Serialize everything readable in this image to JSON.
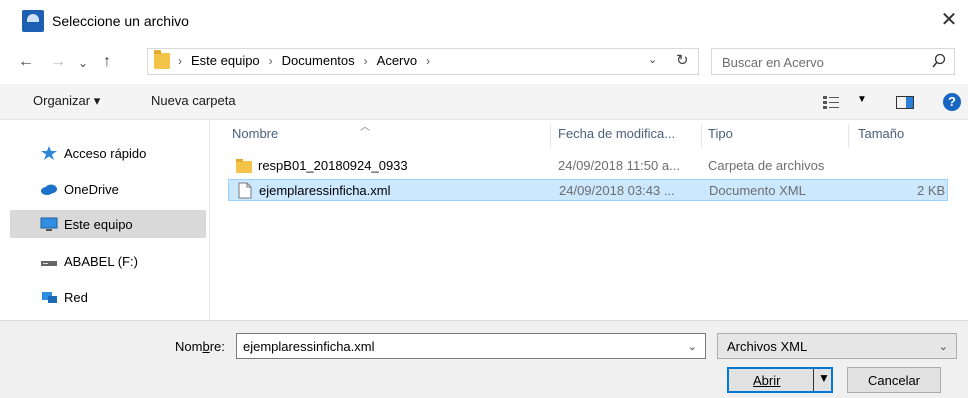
{
  "window": {
    "title": "Seleccione un archivo",
    "close_glyph": "✕"
  },
  "nav": {
    "back_glyph": "←",
    "forward_glyph": "→",
    "recent_glyph": "⌄",
    "up_glyph": "↑",
    "breadcrumbs": [
      "Este equipo",
      "Documentos",
      "Acervo"
    ],
    "crumb_separator": "›",
    "search_placeholder": "Buscar en Acervo"
  },
  "toolbar": {
    "organize_label": "Organizar ▾",
    "new_folder_label": "Nueva carpeta"
  },
  "sidebar": {
    "items": [
      {
        "label": "Acceso rápido",
        "icon": "star-icon"
      },
      {
        "label": "OneDrive",
        "icon": "cloud-icon"
      },
      {
        "label": "Este equipo",
        "icon": "computer-icon",
        "selected": true
      },
      {
        "label": "ABABEL (F:)",
        "icon": "drive-icon"
      },
      {
        "label": "Red",
        "icon": "network-icon"
      }
    ]
  },
  "columns": {
    "name": "Nombre",
    "modified": "Fecha de modifica...",
    "type": "Tipo",
    "size": "Tamaño"
  },
  "files": [
    {
      "name": "respB01_20180924_0933",
      "modified": "24/09/2018 11:50 a...",
      "type": "Carpeta de archivos",
      "size": "",
      "icon": "folder-icon"
    },
    {
      "name": "ejemplaressinficha.xml",
      "modified": "24/09/2018 03:43 ...",
      "type": "Documento XML",
      "size": "2 KB",
      "icon": "document-icon",
      "selected": true
    }
  ],
  "bottom": {
    "filename_label_pre": "Nom",
    "filename_label_accel": "b",
    "filename_label_post": "re:",
    "filename_value": "ejemplaressinficha.xml",
    "filter_value": "Archivos XML",
    "open_label": "Abrir",
    "cancel_label": "Cancelar"
  },
  "colors": {
    "accent": "#0078d7",
    "selection": "#cce8ff",
    "folder": "#f4c34a"
  }
}
